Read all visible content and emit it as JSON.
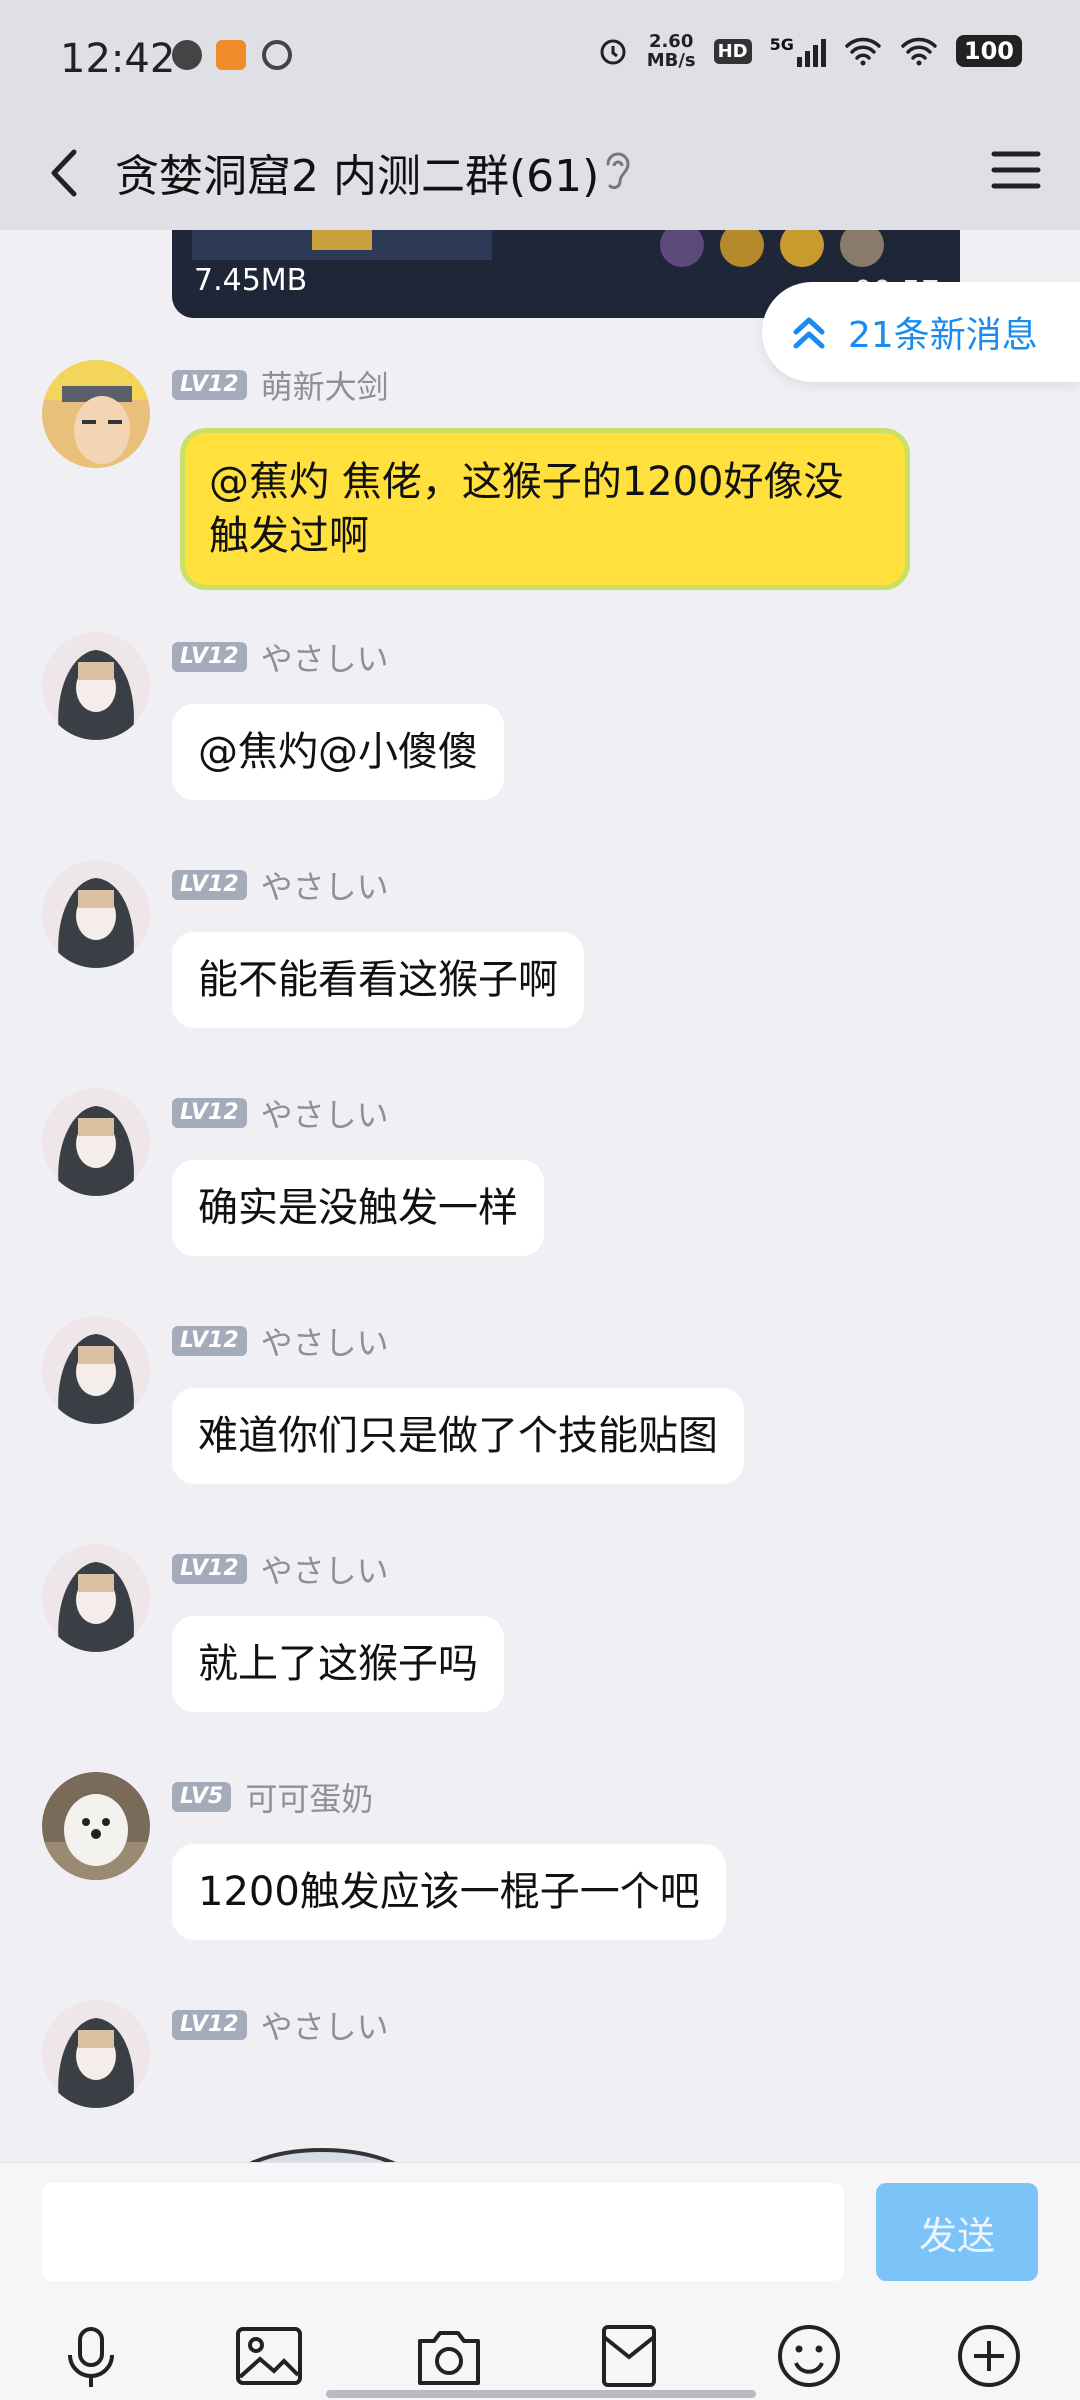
{
  "status_bar": {
    "time": "12:42",
    "net_speed_value": "2.60",
    "net_speed_unit": "MB/s",
    "hd": "HD",
    "network": "5G",
    "battery": "100",
    "icons": [
      "notification-icon",
      "app-icon",
      "location-icon",
      "alarm-icon",
      "signal-icon",
      "wifi-icon",
      "wifi-icon"
    ]
  },
  "header": {
    "title": "贪婪洞窟2 内测二群(61)",
    "icons": [
      "back-icon",
      "earpiece-icon",
      "menu-icon"
    ]
  },
  "video": {
    "size": "7.45MB",
    "duration": "00:57"
  },
  "new_messages": {
    "label": "21条新消息"
  },
  "messages": [
    {
      "level": "LV12",
      "name": "萌新大剑",
      "text": "@蕉灼 焦佬，这猴子的1200好像没触发过啊"
    },
    {
      "level": "LV12",
      "name": "やさしい",
      "text": "@焦灼@小傻傻"
    },
    {
      "level": "LV12",
      "name": "やさしい",
      "text": "能不能看看这猴子啊"
    },
    {
      "level": "LV12",
      "name": "やさしい",
      "text": "确实是没触发一样"
    },
    {
      "level": "LV12",
      "name": "やさしい",
      "text": "难道你们只是做了个技能贴图"
    },
    {
      "level": "LV12",
      "name": "やさしい",
      "text": "就上了这猴子吗"
    },
    {
      "level": "LV5",
      "name": "可可蛋奶",
      "text": "1200触发应该一棍子一个吧"
    },
    {
      "level": "LV12",
      "name": "やさしい",
      "text": ""
    }
  ],
  "input_bar": {
    "send_label": "发送",
    "tools": [
      "microphone-icon",
      "image-icon",
      "camera-icon",
      "red-packet-icon",
      "emoji-icon",
      "plus-icon"
    ]
  },
  "colors": {
    "accent": "#1a8cf0",
    "send_button": "#7cc4f8",
    "highlight_bubble": "#ffe03c"
  }
}
